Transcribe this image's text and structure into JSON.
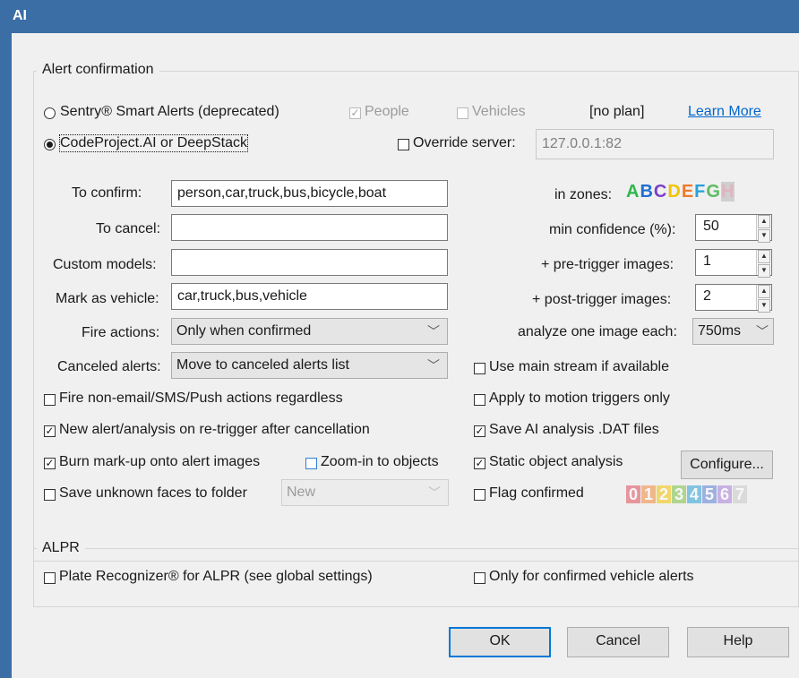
{
  "window": {
    "title": "AI"
  },
  "alert_confirmation": {
    "legend": "Alert confirmation",
    "sentry_label": "Sentry® Smart Alerts (deprecated)",
    "people_label": "People",
    "vehicles_label": "Vehicles",
    "no_plan_text": "[no plan]",
    "learn_more": "Learn More",
    "codeproject_label": "CodeProject.AI or DeepStack",
    "override_label": "Override server:",
    "server_value": "127.0.0.1:82",
    "to_confirm_label": "To confirm:",
    "to_confirm_value": "person,car,truck,bus,bicycle,boat",
    "to_cancel_label": "To cancel:",
    "to_cancel_value": "",
    "custom_models_label": "Custom models:",
    "custom_models_value": "",
    "mark_vehicle_label": "Mark as vehicle:",
    "mark_vehicle_value": "car,truck,bus,vehicle",
    "fire_actions_label": "Fire actions:",
    "fire_actions_value": "Only when confirmed",
    "canceled_alerts_label": "Canceled alerts:",
    "canceled_alerts_value": "Move to canceled alerts list",
    "in_zones_label": "in zones:",
    "zones": [
      {
        "letter": "A",
        "color": "#2db84b"
      },
      {
        "letter": "B",
        "color": "#1f6fd1"
      },
      {
        "letter": "C",
        "color": "#7a3fc8"
      },
      {
        "letter": "D",
        "color": "#f2c400"
      },
      {
        "letter": "E",
        "color": "#ef7a2a"
      },
      {
        "letter": "F",
        "color": "#2aa0d8"
      },
      {
        "letter": "G",
        "color": "#5dbb63"
      },
      {
        "letter": "H",
        "color": "#e0b4c0"
      }
    ],
    "min_conf_label": "min confidence (%):",
    "min_conf_value": "50",
    "pre_trigger_label": "+ pre-trigger images:",
    "pre_trigger_value": "1",
    "post_trigger_label": "+ post-trigger images:",
    "post_trigger_value": "2",
    "analyze_label": "analyze one image each:",
    "analyze_value": "750ms",
    "use_main_stream": "Use main stream if available",
    "fire_non_email": "Fire non-email/SMS/Push actions regardless",
    "apply_motion": "Apply to motion triggers only",
    "new_alert": "New alert/analysis on re-trigger after cancellation",
    "save_dat": "Save AI analysis .DAT files",
    "burn_markup": "Burn mark-up onto alert images",
    "zoom_in": "Zoom-in to objects",
    "static_analysis": "Static object analysis",
    "configure_button": "Configure...",
    "save_faces": "Save unknown faces to folder",
    "faces_folder_value": "New",
    "flag_confirmed": "Flag confirmed",
    "flags": [
      {
        "digit": "0",
        "color": "#e04b5a"
      },
      {
        "digit": "1",
        "color": "#f08a3a"
      },
      {
        "digit": "2",
        "color": "#f2c400"
      },
      {
        "digit": "3",
        "color": "#7ac143"
      },
      {
        "digit": "4",
        "color": "#2aa0d8"
      },
      {
        "digit": "5",
        "color": "#5b7fd6"
      },
      {
        "digit": "6",
        "color": "#a97fd8"
      },
      {
        "digit": "7",
        "color": "#c9c9c9"
      }
    ]
  },
  "alpr": {
    "legend": "ALPR",
    "plate_recognizer": "Plate Recognizer® for ALPR (see global settings)",
    "only_confirmed_vehicle": "Only for confirmed vehicle alerts"
  },
  "buttons": {
    "ok": "OK",
    "cancel": "Cancel",
    "help": "Help"
  },
  "accent_color": "#3a6ea5"
}
